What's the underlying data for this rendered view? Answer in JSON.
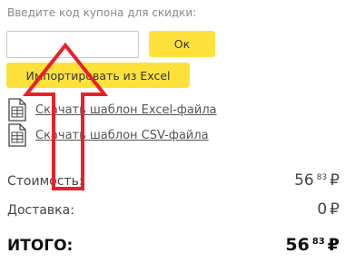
{
  "coupon": {
    "label": "Введите код купона для скидки:",
    "value": "",
    "placeholder": "",
    "ok_label": "Ок"
  },
  "import": {
    "button_label": "Импортировать из Excel"
  },
  "templates": [
    {
      "label": "Скачать шаблон Excel-файла",
      "icon": "excel-file-icon"
    },
    {
      "label": "Скачать шаблон CSV-файла",
      "icon": "csv-file-icon"
    }
  ],
  "summary": {
    "cost_label": "Стоимость:",
    "cost_main": "56",
    "cost_kopecks": "83",
    "currency": "₽",
    "delivery_label": "Доставка:",
    "delivery_value": "0",
    "total_label": "ИТОГО:",
    "total_main": "56",
    "total_kopecks": "83"
  },
  "colors": {
    "button_bg": "#ffe13c",
    "arrow": "#e8212b"
  },
  "annotation": {
    "icon": "red-arrow-up-annotation"
  }
}
